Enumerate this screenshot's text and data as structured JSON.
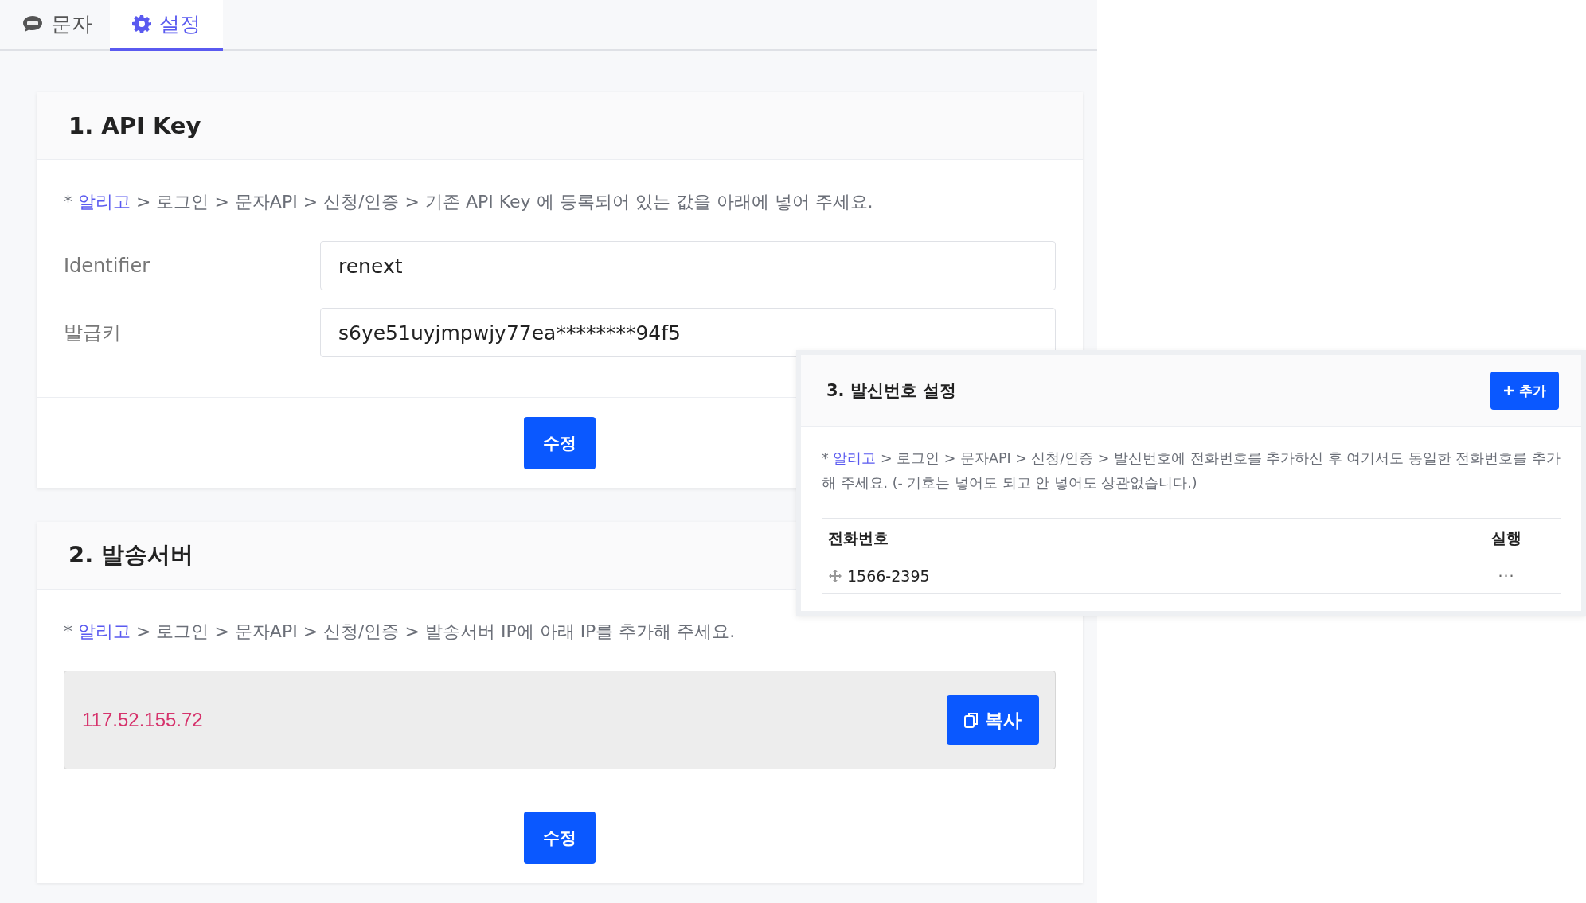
{
  "tabs": [
    {
      "label": "문자",
      "selected": false
    },
    {
      "label": "설정",
      "selected": true
    }
  ],
  "api_key_card": {
    "title": "1. API Key",
    "notice": {
      "prefix": "* ",
      "link": "알리고",
      "text": " > 로그인 > 문자API > 신청/인증 > 기존 API Key 에 등록되어 있는 값을 아래에 넣어 주세요."
    },
    "fields": [
      {
        "label": "Identifier",
        "value": "renext"
      },
      {
        "label": "발급키",
        "value": "s6ye51uyjmpwjy77ea********94f5"
      }
    ],
    "button": "수정"
  },
  "server_card": {
    "title": "2. 발송서버",
    "notice": {
      "prefix": "* ",
      "link": "알리고",
      "text": " > 로그인 > 문자API > 신청/인증 > 발송서버 IP에 아래 IP를 추가해 주세요."
    },
    "ip": "117.52.155.72",
    "copy_button": "복사",
    "button": "수정"
  },
  "sender_panel": {
    "title": "3. 발신번호 설정",
    "add_button": "추가",
    "notice": {
      "prefix": "* ",
      "link": "알리고",
      "text": " > 로그인 > 문자API > 신청/인증 > 발신번호에 전화번호를 추가하신 후 여기서도 동일한 전화번호를 추가해 주세요. (- 기호는 넣어도 되고 안 넣어도 상관없습니다.)"
    },
    "table": {
      "columns": [
        "전화번호",
        "실행"
      ],
      "rows": [
        {
          "number": "1566-2395",
          "action": "···"
        }
      ]
    }
  }
}
